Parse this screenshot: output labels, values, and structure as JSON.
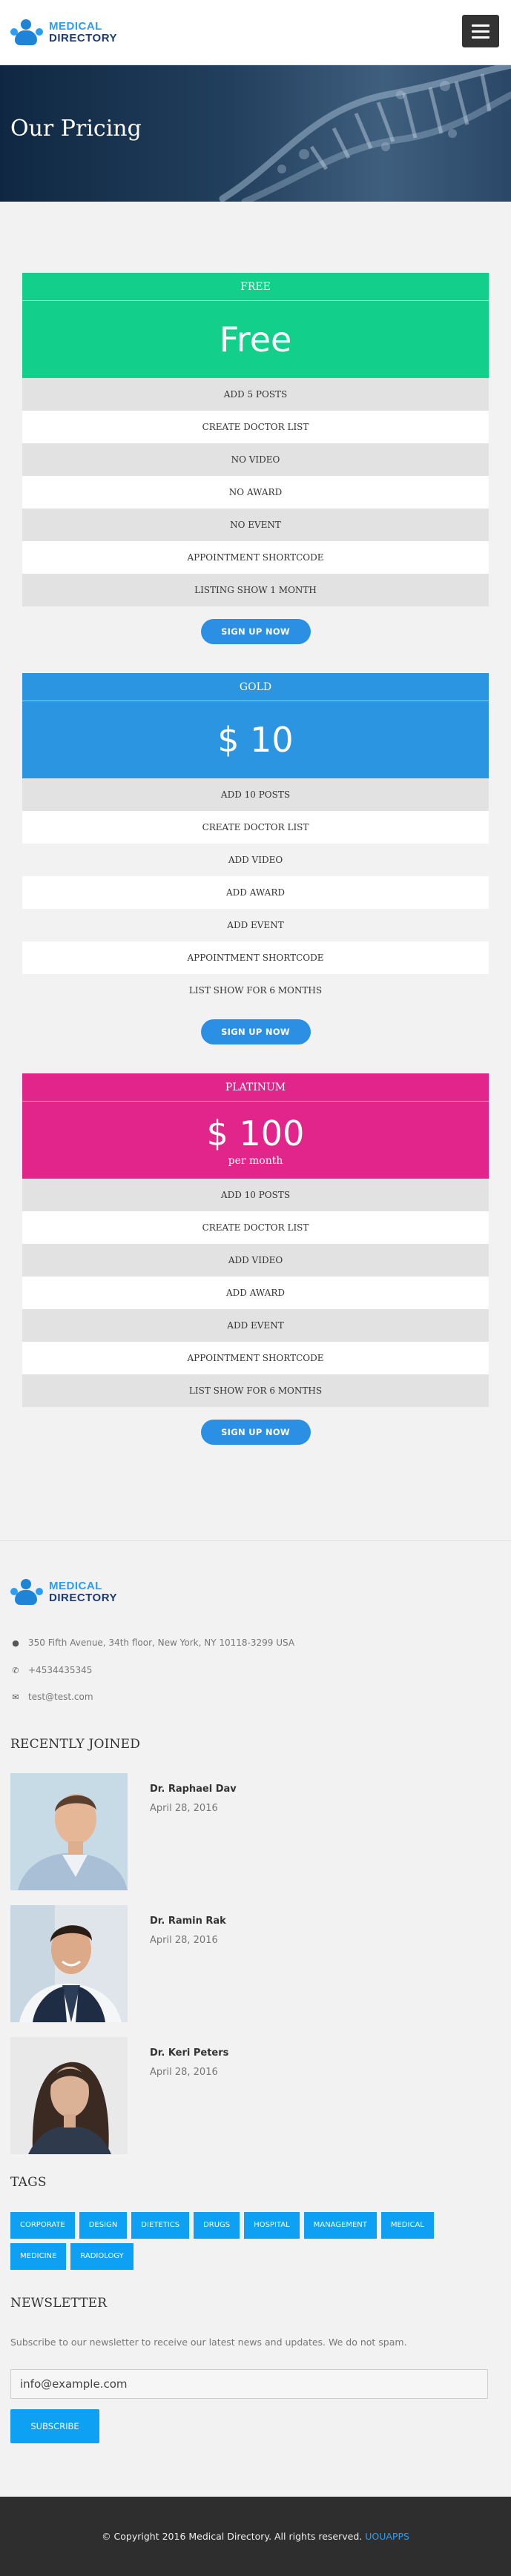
{
  "brand": {
    "line1": "MEDICAL",
    "line2": "DIRECTORY"
  },
  "hero": {
    "title": "Our Pricing"
  },
  "plans": [
    {
      "name": "FREE",
      "price": "Free",
      "period": "",
      "color": "#12d08c",
      "features": [
        "ADD 5 POSTS",
        "CREATE DOCTOR LIST",
        "NO VIDEO",
        "NO AWARD",
        "NO EVENT",
        "APPOINTMENT SHORTCODE",
        "LISTING SHOW 1 MONTH"
      ],
      "button": "SIGN UP NOW"
    },
    {
      "name": "GOLD",
      "price": "$ 10",
      "period": "",
      "color": "#2b95e2",
      "features": [
        "ADD 10 POSTS",
        "CREATE DOCTOR LIST",
        "ADD VIDEO",
        "ADD AWARD",
        "ADD EVENT",
        "APPOINTMENT SHORTCODE",
        "LIST SHOW FOR 6 MONTHS"
      ],
      "button": "SIGN UP NOW"
    },
    {
      "name": "PLATINUM",
      "price": "$ 100",
      "period": "per month",
      "color": "#e2258b",
      "features": [
        "ADD 10 POSTS",
        "CREATE DOCTOR LIST",
        "ADD VIDEO",
        "ADD AWARD",
        "ADD EVENT",
        "APPOINTMENT SHORTCODE",
        "LIST SHOW FOR 6 MONTHS"
      ],
      "button": "SIGN UP NOW"
    }
  ],
  "contact": {
    "address": "350 Fifth Avenue, 34th floor, New York, NY 10118-3299 USA",
    "phone": "+4534435345",
    "email": "test@test.com"
  },
  "recent": {
    "title": "RECENTLY JOINED",
    "doctors": [
      {
        "name": "Dr. Raphael Dav",
        "date": "April 28, 2016"
      },
      {
        "name": "Dr. Ramin Rak",
        "date": "April 28, 2016"
      },
      {
        "name": "Dr. Keri Peters",
        "date": "April 28, 2016"
      }
    ]
  },
  "tags": {
    "title": "TAGS",
    "items": [
      "CORPORATE",
      "DESIGN",
      "DIETETICS",
      "DRUGS",
      "HOSPITAL",
      "MANAGEMENT",
      "MEDICAL",
      "MEDICINE",
      "RADIOLOGY"
    ]
  },
  "newsletter": {
    "title": "NEWSLETTER",
    "text": "Subscribe to our newsletter to receive our latest news and updates. We do not spam.",
    "input_value": "info@example.com",
    "button": "SUBSCRIBE"
  },
  "footer": {
    "copyright": "© Copyright 2016 Medical Directory. All rights reserved.",
    "link": "UOUAPPS"
  },
  "colors": {
    "accent": "#0ea0f2",
    "dark": "#2e2e2e"
  }
}
